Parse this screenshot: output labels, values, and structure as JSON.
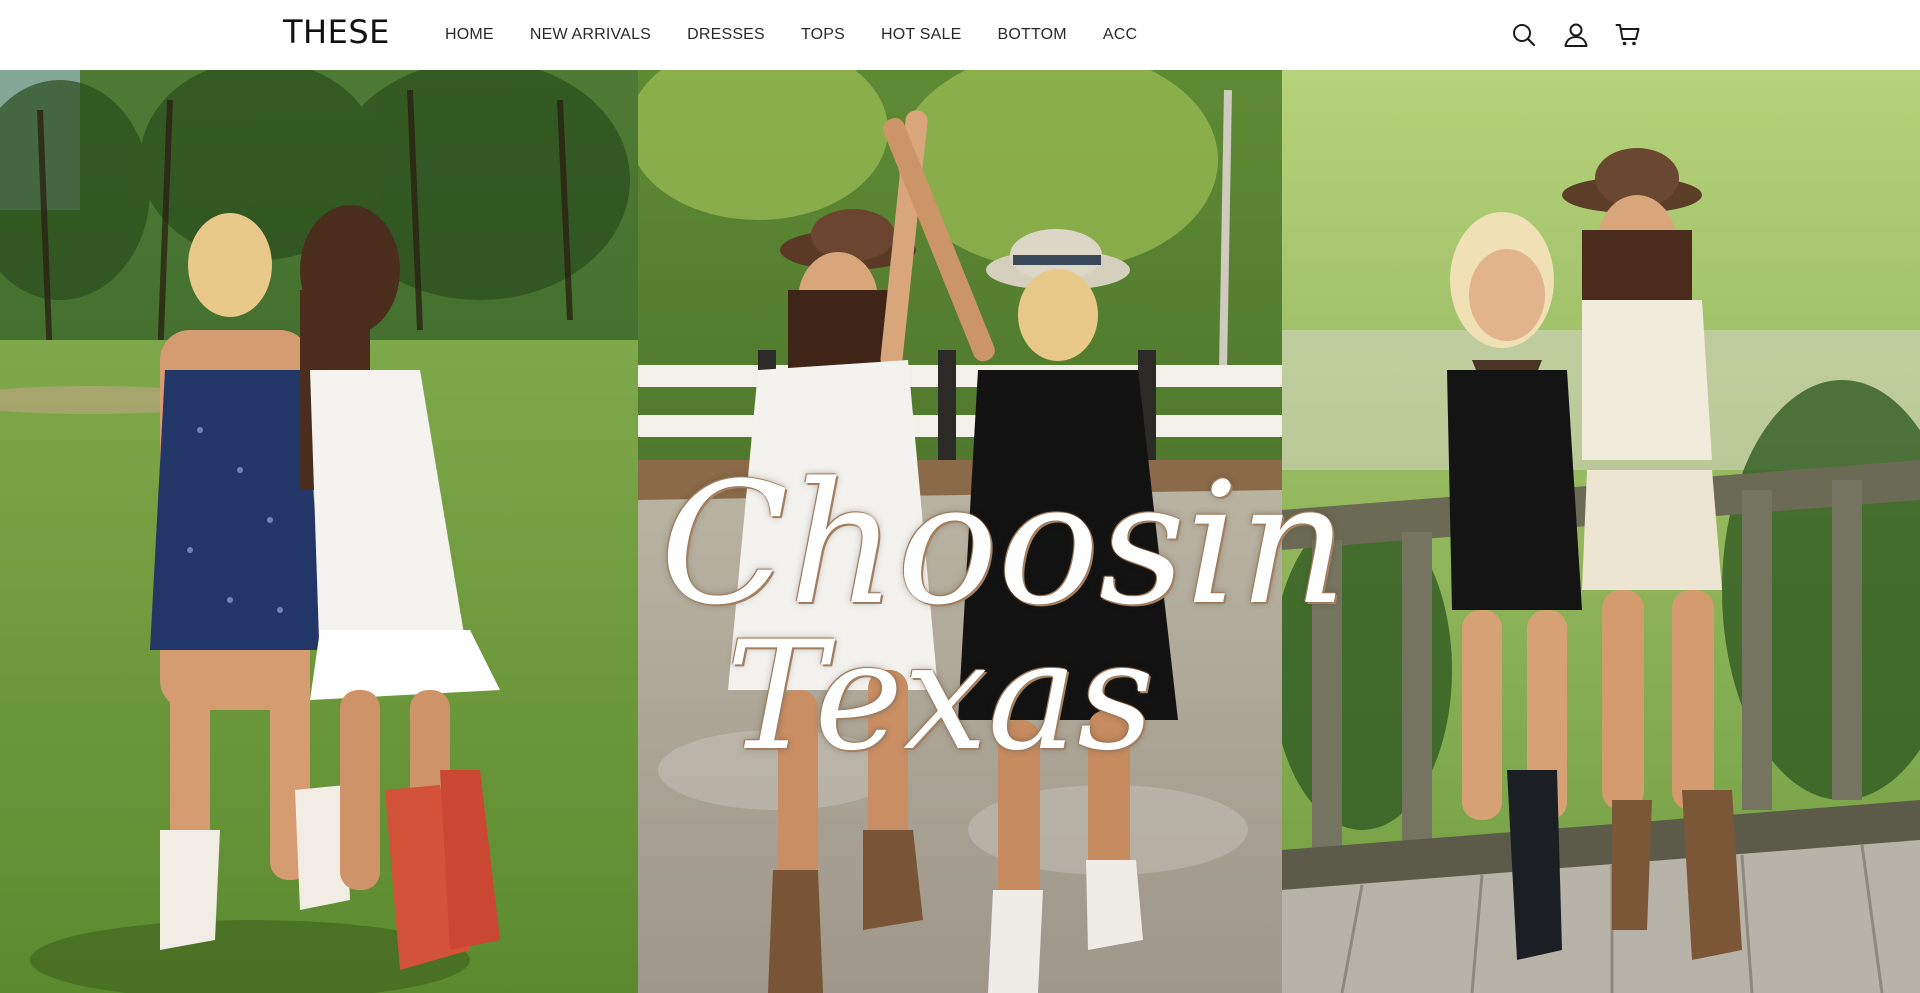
{
  "header": {
    "logo": "THESE",
    "nav": [
      "HOME",
      "NEW ARRIVALS",
      "DRESSES",
      "TOPS",
      "HOT SALE",
      "BOTTOM",
      "ACC"
    ],
    "icons": [
      "search-icon",
      "account-icon",
      "cart-icon"
    ]
  },
  "hero": {
    "headline_line1": "Choosin",
    "headline_line2": "Texas",
    "colors": {
      "foliage": "#3f6b2a",
      "grass": "#6f9a3e",
      "fence": "#f3f0ea",
      "porch": "#6b6a55"
    }
  }
}
